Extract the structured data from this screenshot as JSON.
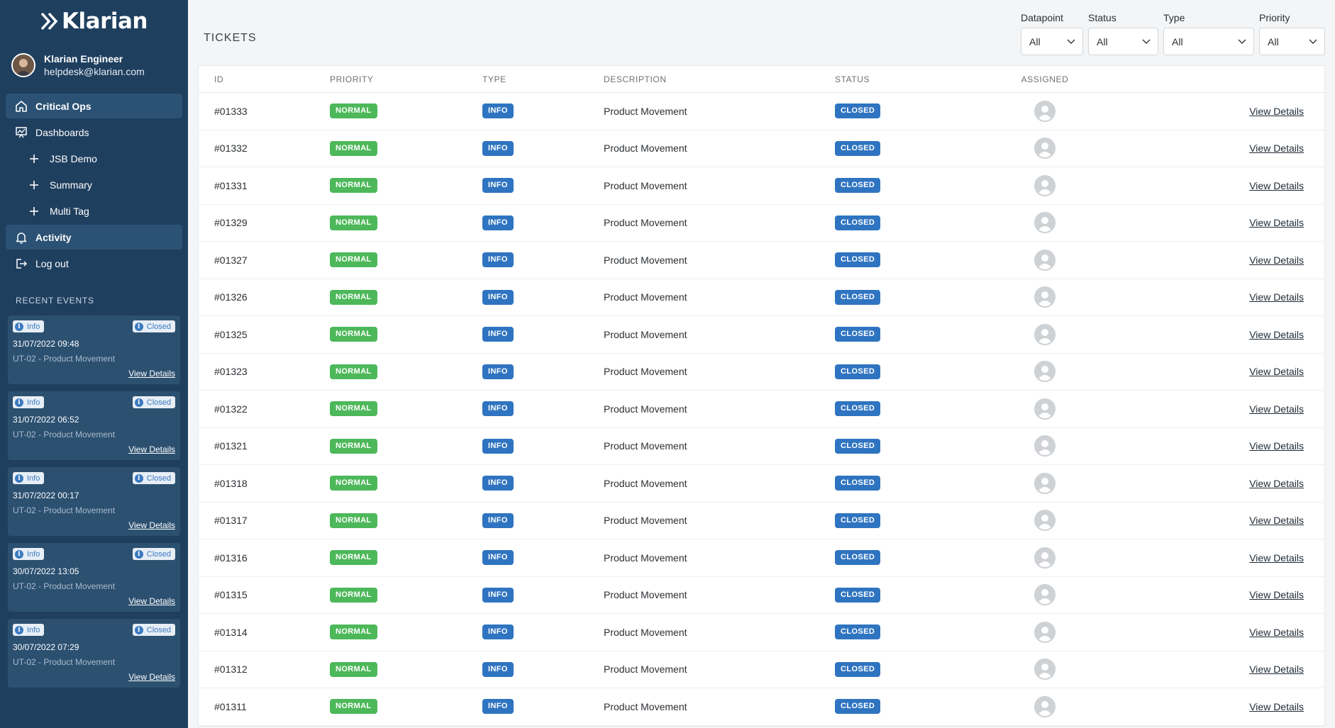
{
  "brand": {
    "logo_text": "Klarian"
  },
  "user": {
    "name": "Klarian Engineer",
    "email": "helpdesk@klarian.com"
  },
  "nav": [
    {
      "label": "Critical Ops",
      "icon": "home-icon",
      "active": true
    },
    {
      "label": "Dashboards",
      "icon": "presentation-chart-icon",
      "active": false
    },
    {
      "label": "JSB Demo",
      "icon": "plus-icon",
      "sub": true
    },
    {
      "label": "Summary",
      "icon": "plus-icon",
      "sub": true
    },
    {
      "label": "Multi Tag",
      "icon": "plus-icon",
      "sub": true
    },
    {
      "label": "Activity",
      "icon": "bell-icon",
      "active": true
    },
    {
      "label": "Log out",
      "icon": "logout-icon",
      "active": false
    }
  ],
  "recent_events": {
    "title": "RECENT EVENTS",
    "items": [
      {
        "type": "Info",
        "status": "Closed",
        "date": "31/07/2022 09:48",
        "desc": "UT-02 - Product Movement",
        "link": "View Details"
      },
      {
        "type": "Info",
        "status": "Closed",
        "date": "31/07/2022 06:52",
        "desc": "UT-02 - Product Movement",
        "link": "View Details"
      },
      {
        "type": "Info",
        "status": "Closed",
        "date": "31/07/2022 00:17",
        "desc": "UT-02 - Product Movement",
        "link": "View Details"
      },
      {
        "type": "Info",
        "status": "Closed",
        "date": "30/07/2022 13:05",
        "desc": "UT-02 - Product Movement",
        "link": "View Details"
      },
      {
        "type": "Info",
        "status": "Closed",
        "date": "30/07/2022 07:29",
        "desc": "UT-02 - Product Movement",
        "link": "View Details"
      }
    ]
  },
  "main": {
    "title": "TICKETS",
    "filters": [
      {
        "label": "Datapoint",
        "value": "All"
      },
      {
        "label": "Status",
        "value": "All"
      },
      {
        "label": "Type",
        "value": "All"
      },
      {
        "label": "Priority",
        "value": "All"
      }
    ],
    "columns": {
      "id": "ID",
      "priority": "PRIORITY",
      "type": "TYPE",
      "description": "DESCRIPTION",
      "status": "STATUS",
      "assigned": "ASSIGNED"
    },
    "rows": [
      {
        "id": "#01333",
        "priority": "NORMAL",
        "type": "INFO",
        "description": "Product Movement",
        "status": "CLOSED",
        "action": "View Details"
      },
      {
        "id": "#01332",
        "priority": "NORMAL",
        "type": "INFO",
        "description": "Product Movement",
        "status": "CLOSED",
        "action": "View Details"
      },
      {
        "id": "#01331",
        "priority": "NORMAL",
        "type": "INFO",
        "description": "Product Movement",
        "status": "CLOSED",
        "action": "View Details"
      },
      {
        "id": "#01329",
        "priority": "NORMAL",
        "type": "INFO",
        "description": "Product Movement",
        "status": "CLOSED",
        "action": "View Details"
      },
      {
        "id": "#01327",
        "priority": "NORMAL",
        "type": "INFO",
        "description": "Product Movement",
        "status": "CLOSED",
        "action": "View Details"
      },
      {
        "id": "#01326",
        "priority": "NORMAL",
        "type": "INFO",
        "description": "Product Movement",
        "status": "CLOSED",
        "action": "View Details"
      },
      {
        "id": "#01325",
        "priority": "NORMAL",
        "type": "INFO",
        "description": "Product Movement",
        "status": "CLOSED",
        "action": "View Details"
      },
      {
        "id": "#01323",
        "priority": "NORMAL",
        "type": "INFO",
        "description": "Product Movement",
        "status": "CLOSED",
        "action": "View Details"
      },
      {
        "id": "#01322",
        "priority": "NORMAL",
        "type": "INFO",
        "description": "Product Movement",
        "status": "CLOSED",
        "action": "View Details"
      },
      {
        "id": "#01321",
        "priority": "NORMAL",
        "type": "INFO",
        "description": "Product Movement",
        "status": "CLOSED",
        "action": "View Details"
      },
      {
        "id": "#01318",
        "priority": "NORMAL",
        "type": "INFO",
        "description": "Product Movement",
        "status": "CLOSED",
        "action": "View Details"
      },
      {
        "id": "#01317",
        "priority": "NORMAL",
        "type": "INFO",
        "description": "Product Movement",
        "status": "CLOSED",
        "action": "View Details"
      },
      {
        "id": "#01316",
        "priority": "NORMAL",
        "type": "INFO",
        "description": "Product Movement",
        "status": "CLOSED",
        "action": "View Details"
      },
      {
        "id": "#01315",
        "priority": "NORMAL",
        "type": "INFO",
        "description": "Product Movement",
        "status": "CLOSED",
        "action": "View Details"
      },
      {
        "id": "#01314",
        "priority": "NORMAL",
        "type": "INFO",
        "description": "Product Movement",
        "status": "CLOSED",
        "action": "View Details"
      },
      {
        "id": "#01312",
        "priority": "NORMAL",
        "type": "INFO",
        "description": "Product Movement",
        "status": "CLOSED",
        "action": "View Details"
      },
      {
        "id": "#01311",
        "priority": "NORMAL",
        "type": "INFO",
        "description": "Product Movement",
        "status": "CLOSED",
        "action": "View Details"
      }
    ]
  },
  "colors": {
    "sidebar": "#1f3f5f",
    "normal": "#4db85a",
    "info": "#2f74c0",
    "closed": "#2f74c0"
  }
}
